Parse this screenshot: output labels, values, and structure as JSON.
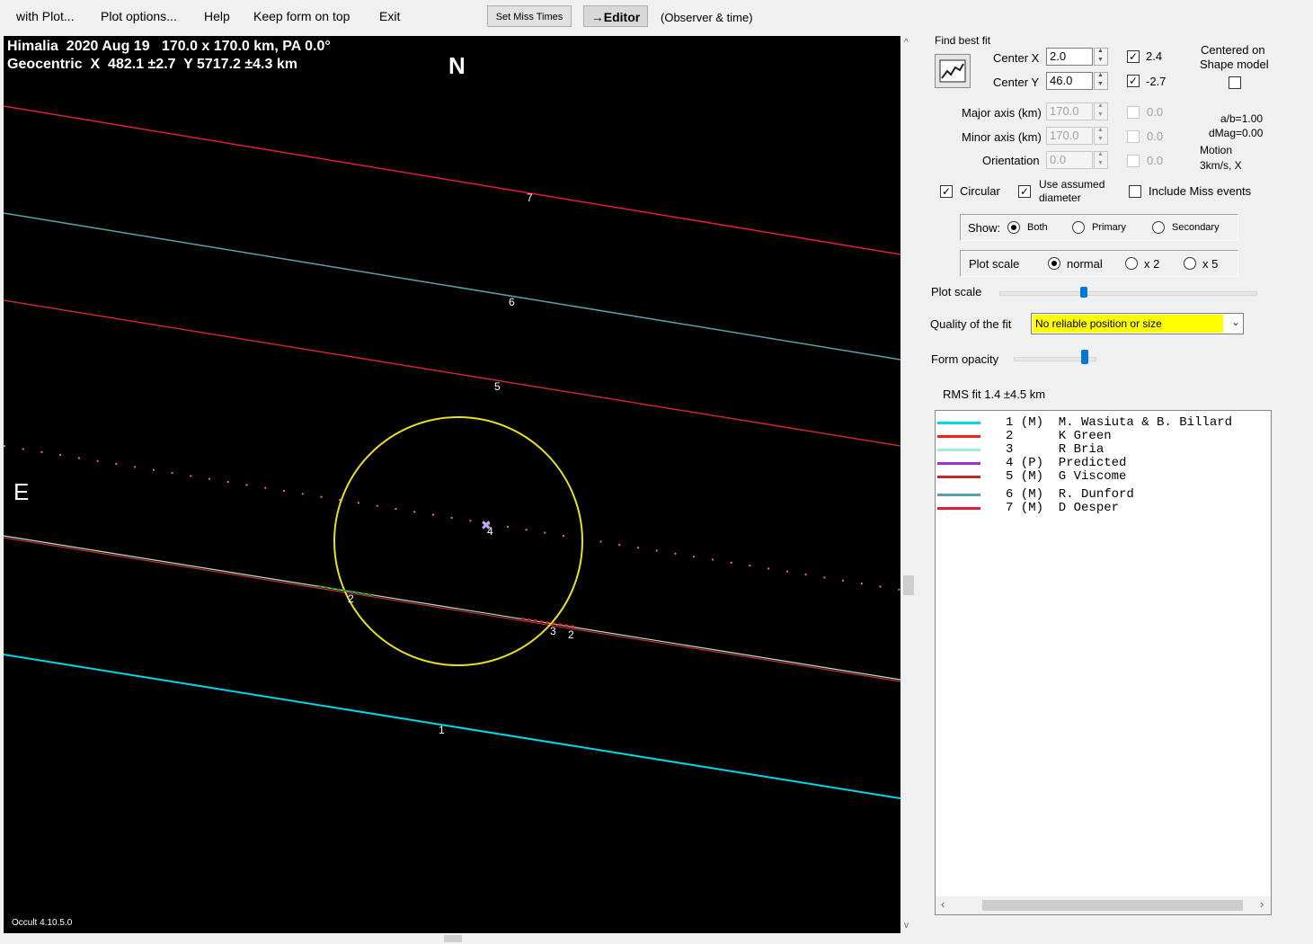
{
  "menu": {
    "with_plot": "with Plot...",
    "plot_options": "Plot options...",
    "help": "Help",
    "keep_on_top": "Keep form on top",
    "exit": "Exit",
    "set_miss_times": "Set Miss Times",
    "editor": "→Editor",
    "observer_time": "(Observer & time)"
  },
  "plot": {
    "header_line1": "Himalia  2020 Aug 19   170.0 x 170.0 km, PA 0.0°",
    "header_line2": "Geocentric  X  482.1 ±2.7  Y 5717.2 ±4.3 km",
    "north": "N",
    "east": "E",
    "version": "Occult 4.10.5.0",
    "chord_labels": [
      "7",
      "6",
      "5",
      "4",
      "3",
      "2",
      "2",
      "1"
    ],
    "colors": {
      "chord1": "#00d8e8",
      "chord5": "#c8282c",
      "chord6": "#5aa2a8",
      "chord7": "#e01e3c",
      "predicted": "#ff6a6a",
      "ellipse": "#e8e020",
      "chords23": "#c83030"
    }
  },
  "panel": {
    "find_best_fit": "Find best fit",
    "center_x_label": "Center X",
    "center_x": "2.0",
    "center_x_fit": "2.4",
    "center_y_label": "Center Y",
    "center_y": "46.0",
    "center_y_fit": "-2.7",
    "centered_on": "Centered on",
    "shape_model": "Shape model",
    "major_axis_label": "Major axis (km)",
    "major_axis": "170.0",
    "major_fit": "0.0",
    "minor_axis_label": "Minor axis (km)",
    "minor_axis": "170.0",
    "minor_fit": "0.0",
    "orientation_label": "Orientation",
    "orientation": "0.0",
    "orientation_fit": "0.0",
    "ab": "a/b=1.00",
    "dmag": "dMag=0.00",
    "motion": "Motion",
    "motion_value": "3km/s, X",
    "circular": "Circular",
    "use_assumed_1": "Use assumed",
    "use_assumed_2": "diameter",
    "include_miss": "Include Miss events",
    "show_label": "Show:",
    "show_both": "Both",
    "show_primary": "Primary",
    "show_secondary": "Secondary",
    "plot_scale_group": "Plot scale",
    "scale_normal": "normal",
    "scale_x2": "x 2",
    "scale_x5": "x 5",
    "plot_scale_slider": "Plot scale",
    "quality_label": "Quality of the fit",
    "quality_value": "No reliable position or size",
    "quality_color": "#ffff00",
    "form_opacity": "Form opacity",
    "rms_fit": "RMS fit  1.4 ±4.5 km"
  },
  "legend": [
    {
      "text": "1 (M)  M. Wasiuta & B. Billard",
      "color": "#00d8e8"
    },
    {
      "text": "2      K Green",
      "color": "#ff1e1e"
    },
    {
      "text": "3      R Bria",
      "color": "#9ef0d0"
    },
    {
      "text": "4 (P)  Predicted",
      "color": "#9b30e0"
    },
    {
      "text": "5 (M)  G Viscome",
      "color": "#c0282a"
    },
    {
      "text": "6 (M)  R. Dunford",
      "color": "#5aa2a8"
    },
    {
      "text": "7 (M)  D Oesper",
      "color": "#e01e3c"
    }
  ]
}
